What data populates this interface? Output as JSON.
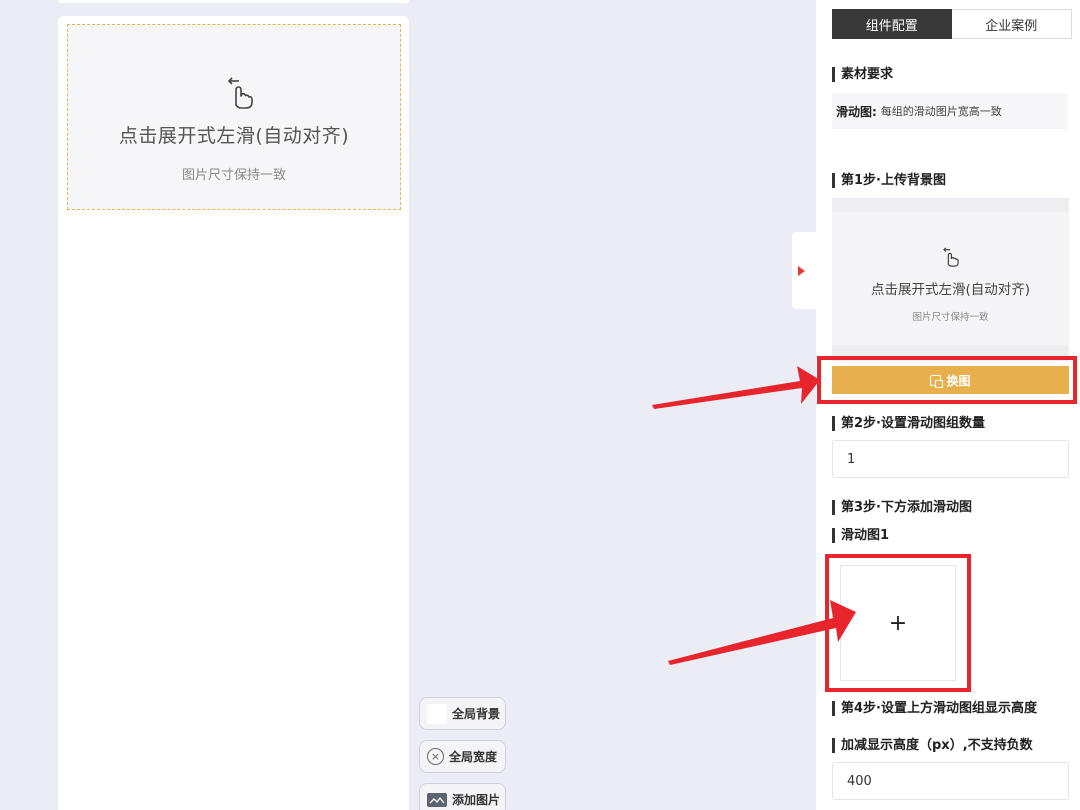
{
  "preview": {
    "title": "点击展开式左滑(自动对齐)",
    "subtitle": "图片尺寸保持一致"
  },
  "floating_toolbar": {
    "global_bg": "全局背景",
    "global_width": "全局宽度",
    "add_image": "添加图片"
  },
  "config": {
    "tabs": [
      "组件配置",
      "企业案例"
    ],
    "material_title": "素材要求",
    "material_key": "滑动图:",
    "material_value": "每组的滑动图片宽高一致",
    "step1": "第1步·上传背景图",
    "bg_title": "点击展开式左滑(自动对齐)",
    "bg_subtitle": "图片尺寸保持一致",
    "replace_label": "换图",
    "step2": "第2步·设置滑动图组数量",
    "group_count": "1",
    "step3": "第3步·下方添加滑动图",
    "slide1": "滑动图1",
    "add_symbol": "+",
    "step4": "第4步·设置上方滑动图组显示高度",
    "height_label": "加减显示高度（px）,不支持负数",
    "height_value": "400"
  },
  "colors": {
    "accent": "#e7b04d",
    "annotation_red": "#e8242d",
    "dark_tab": "#393939"
  }
}
